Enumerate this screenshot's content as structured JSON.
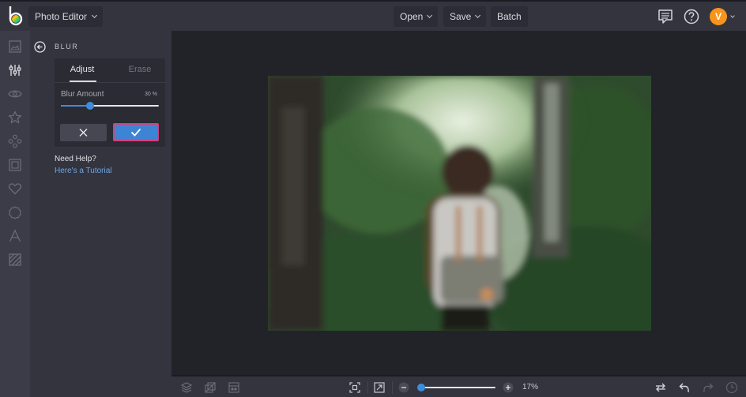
{
  "header": {
    "app_menu_label": "Photo Editor",
    "open_label": "Open",
    "save_label": "Save",
    "batch_label": "Batch",
    "user_initial": "V",
    "icons": [
      "logo-icon",
      "comment-icon",
      "help-icon"
    ]
  },
  "rail": {
    "items": [
      {
        "name": "image",
        "icon": "image-icon",
        "active": false
      },
      {
        "name": "edit",
        "icon": "sliders-icon",
        "active": true
      },
      {
        "name": "touch-up",
        "icon": "eye-icon",
        "active": false
      },
      {
        "name": "effects",
        "icon": "star-icon",
        "active": false
      },
      {
        "name": "overlays",
        "icon": "shapes-icon",
        "active": false
      },
      {
        "name": "frames",
        "icon": "frame-icon",
        "active": false
      },
      {
        "name": "graphics",
        "icon": "heart-icon",
        "active": false
      },
      {
        "name": "textures",
        "icon": "badge-icon",
        "active": false
      },
      {
        "name": "text",
        "icon": "text-icon",
        "active": false
      },
      {
        "name": "pattern",
        "icon": "hatch-icon",
        "active": false
      }
    ]
  },
  "panel": {
    "title": "BLUR",
    "tabs": [
      {
        "label": "Adjust",
        "active": true
      },
      {
        "label": "Erase",
        "active": false
      }
    ],
    "slider": {
      "label": "Blur Amount",
      "value_text": "30 %",
      "value": 30,
      "max": 100
    },
    "help_title": "Need Help?",
    "help_link": "Here's a Tutorial"
  },
  "canvas": {
    "photo_description": "Blurred photo of a woman with a backpack walking in a forest"
  },
  "footer": {
    "zoom_text": "17%",
    "zoom_fraction": 0.0
  },
  "colors": {
    "accent": "#3e8ddd",
    "highlight_border": "#d2417f",
    "avatar": "#f7941d",
    "link": "#6ea6e6"
  }
}
